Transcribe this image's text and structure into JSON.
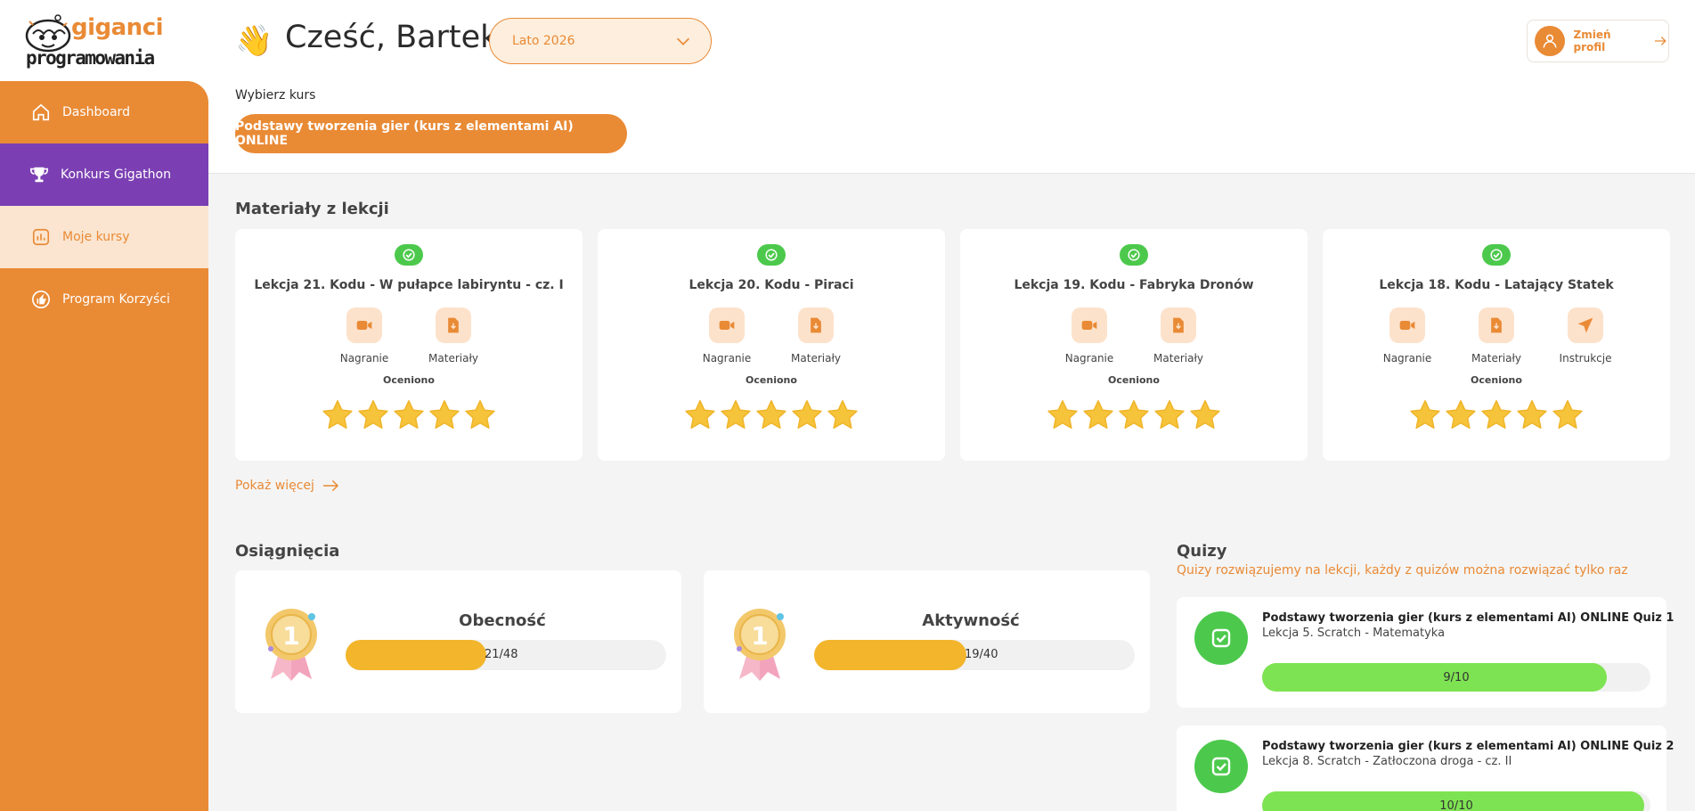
{
  "brand": {
    "logo_top": "giganci",
    "logo_bottom": "programowania",
    "accent": "#e98a35",
    "purple": "#7b3fb3"
  },
  "sidebar": {
    "items": [
      {
        "label": "Dashboard",
        "icon": "home-icon"
      },
      {
        "label": "Konkurs Gigathon",
        "icon": "trophy-icon"
      },
      {
        "label": "Moje kursy",
        "icon": "chart-icon"
      },
      {
        "label": "Program Korzyści",
        "icon": "thumbs-up-icon"
      }
    ]
  },
  "header": {
    "wave": "👋",
    "greeting": "Cześć, Bartek",
    "season": "Lato 2026",
    "choose_course_label": "Wybierz kurs",
    "selected_course": "Podstawy tworzenia gier (kurs z elementami AI) ONLINE",
    "profile_button": "Zmień profil"
  },
  "materials": {
    "title": "Materiały z lekcji",
    "lessons": [
      {
        "title": "Lekcja 21. Kodu - W pułapce labiryntu - cz. I",
        "actions": [
          "Nagranie",
          "Materiały"
        ],
        "status": "Oceniono",
        "stars": 5
      },
      {
        "title": "Lekcja 20. Kodu - Piraci",
        "actions": [
          "Nagranie",
          "Materiały"
        ],
        "status": "Oceniono",
        "stars": 5
      },
      {
        "title": "Lekcja 19. Kodu - Fabryka Dronów",
        "actions": [
          "Nagranie",
          "Materiały"
        ],
        "status": "Oceniono",
        "stars": 5
      },
      {
        "title": "Lekcja 18. Kodu - Latający Statek",
        "actions": [
          "Nagranie",
          "Materiały",
          "Instrukcje"
        ],
        "status": "Oceniono",
        "stars": 5
      }
    ],
    "show_more": "Pokaż więcej"
  },
  "achievements": {
    "title": "Osiągnięcia",
    "items": [
      {
        "name": "Obecność",
        "value": 21,
        "max": 48,
        "label": "21/48"
      },
      {
        "name": "Aktywność",
        "value": 19,
        "max": 40,
        "label": "19/40"
      }
    ]
  },
  "quizzes": {
    "title": "Quizy",
    "subtitle": "Quizy rozwiązujemy na lekcji, każdy z quizów można rozwiązać tylko raz",
    "items": [
      {
        "title": "Podstawy tworzenia gier (kurs z elementami AI) ONLINE Quiz 1",
        "lesson": "Lekcja 5. Scratch - Matematyka",
        "score": 9,
        "max": 10,
        "label": "9/10"
      },
      {
        "title": "Podstawy tworzenia gier (kurs z elementami AI) ONLINE Quiz 2",
        "lesson": "Lekcja 8. Scratch - Zatłoczona droga - cz. II",
        "score": 10,
        "max": 10,
        "label": "10/10"
      }
    ]
  }
}
